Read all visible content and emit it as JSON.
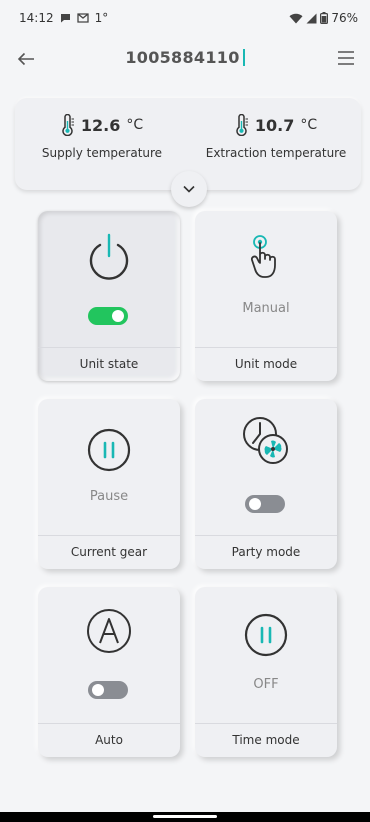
{
  "status_bar": {
    "time": "14:12",
    "extra": "1°",
    "battery": "76%"
  },
  "app_bar": {
    "title": "1005884110",
    "back_icon": "arrow-left-icon",
    "menu_icon": "hamburger-menu-icon"
  },
  "temperatures": {
    "supply": {
      "value": "12.6",
      "unit": "°C",
      "label": "Supply temperature"
    },
    "extraction": {
      "value": "10.7",
      "unit": "°C",
      "label": "Extraction temperature"
    }
  },
  "tiles": {
    "unit_state": {
      "label": "Unit state",
      "toggle_on": true
    },
    "unit_mode": {
      "label": "Unit mode",
      "value": "Manual"
    },
    "current_gear": {
      "label": "Current gear",
      "value": "Pause"
    },
    "party_mode": {
      "label": "Party mode",
      "toggle_on": false
    },
    "auto": {
      "label": "Auto",
      "toggle_on": false
    },
    "time_mode": {
      "label": "Time mode",
      "value": "OFF"
    }
  },
  "colors": {
    "accent": "#19b8b4",
    "toggle_on": "#22c55e",
    "toggle_off": "#8a8d93",
    "background": "#f4f5f7"
  }
}
